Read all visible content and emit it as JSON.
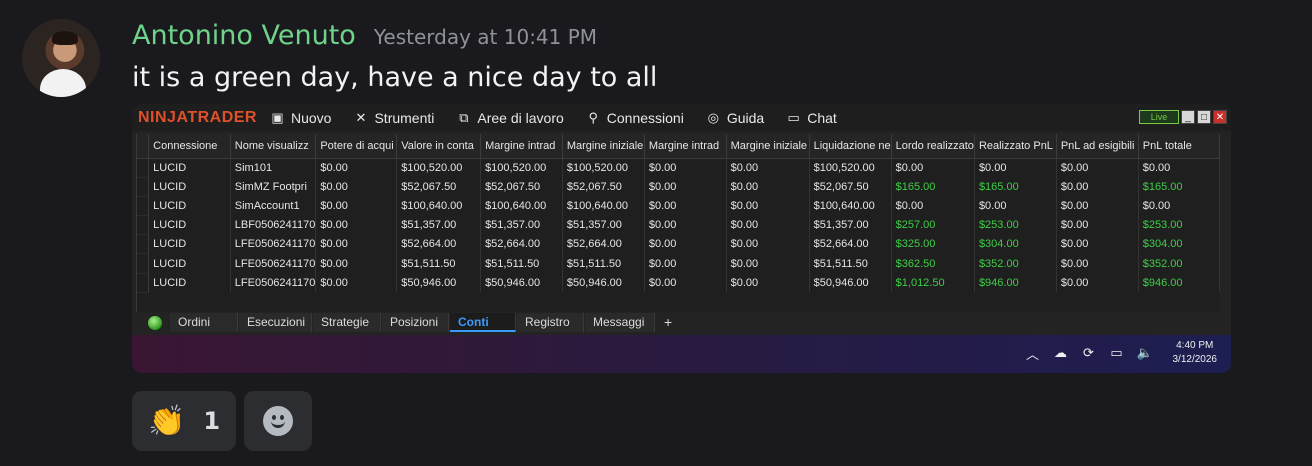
{
  "message": {
    "author": "Antonino Venuto",
    "author_color": "#6fd38a",
    "timestamp": "Yesterday at 10:41 PM",
    "text": "it is a green day, have a nice day to all"
  },
  "ninjatrader": {
    "logo": "NINJATRADER",
    "menu": [
      {
        "label": "Nuovo",
        "icon": "new-window-icon"
      },
      {
        "label": "Strumenti",
        "icon": "tools-icon"
      },
      {
        "label": "Aree di lavoro",
        "icon": "workspace-icon"
      },
      {
        "label": "Connessioni",
        "icon": "plug-icon"
      },
      {
        "label": "Guida",
        "icon": "help-icon"
      },
      {
        "label": "Chat",
        "icon": "chat-icon"
      }
    ],
    "live_label": "Live",
    "columns": [
      "Connessione",
      "Nome visualizz",
      "Potere di acqui",
      "Valore in conta",
      "Margine intrad",
      "Margine iniziale",
      "Margine intrad",
      "Margine iniziale",
      "Liquidazione ne",
      "Lordo realizzato",
      "Realizzato PnL",
      "PnL ad esigibili",
      "PnL totale"
    ],
    "rows": [
      [
        "LUCID",
        "Sim101",
        "$0.00",
        "$100,520.00",
        "$100,520.00",
        "$100,520.00",
        "$0.00",
        "$0.00",
        "$100,520.00",
        "$0.00",
        "$0.00",
        "$0.00",
        "$0.00"
      ],
      [
        "LUCID",
        "SimMZ Footpri",
        "$0.00",
        "$52,067.50",
        "$52,067.50",
        "$52,067.50",
        "$0.00",
        "$0.00",
        "$52,067.50",
        "$165.00",
        "$165.00",
        "$0.00",
        "$165.00"
      ],
      [
        "LUCID",
        "SimAccount1",
        "$0.00",
        "$100,640.00",
        "$100,640.00",
        "$100,640.00",
        "$0.00",
        "$0.00",
        "$100,640.00",
        "$0.00",
        "$0.00",
        "$0.00",
        "$0.00"
      ],
      [
        "LUCID",
        "LBF0506241170",
        "$0.00",
        "$51,357.00",
        "$51,357.00",
        "$51,357.00",
        "$0.00",
        "$0.00",
        "$51,357.00",
        "$257.00",
        "$253.00",
        "$0.00",
        "$253.00"
      ],
      [
        "LUCID",
        "LFE0506241170",
        "$0.00",
        "$52,664.00",
        "$52,664.00",
        "$52,664.00",
        "$0.00",
        "$0.00",
        "$52,664.00",
        "$325.00",
        "$304.00",
        "$0.00",
        "$304.00"
      ],
      [
        "LUCID",
        "LFE0506241170",
        "$0.00",
        "$51,511.50",
        "$51,511.50",
        "$51,511.50",
        "$0.00",
        "$0.00",
        "$51,511.50",
        "$362.50",
        "$352.00",
        "$0.00",
        "$352.00"
      ],
      [
        "LUCID",
        "LFE0506241170",
        "$0.00",
        "$50,946.00",
        "$50,946.00",
        "$50,946.00",
        "$0.00",
        "$0.00",
        "$50,946.00",
        "$1,012.50",
        "$946.00",
        "$0.00",
        "$946.00"
      ]
    ],
    "tabs": [
      "Ordini",
      "Esecuzioni",
      "Strategie",
      "Posizioni",
      "Conti",
      "Registro",
      "Messaggi"
    ],
    "active_tab": "Conti",
    "positive_color": "#3ecf46"
  },
  "taskbar": {
    "time": "4:40 PM",
    "date": "3/12/2026"
  },
  "reactions": [
    {
      "emoji": "👏",
      "count": "1"
    }
  ]
}
